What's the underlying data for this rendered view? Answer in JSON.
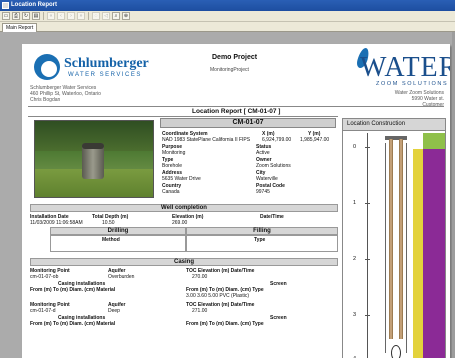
{
  "window": {
    "title": "Location Report"
  },
  "toolbar": {
    "buttons": [
      "open-icon",
      "print-icon",
      "refresh-icon",
      "export-icon",
      "first-page-icon",
      "prev-page-icon",
      "next-page-icon",
      "last-page-icon",
      "stop-icon",
      "back-icon",
      "find-icon",
      "zoom-icon"
    ]
  },
  "tabs": [
    {
      "label": "Main Report"
    }
  ],
  "header": {
    "company_left": "Schlumberger",
    "company_left_sub": "WATER SERVICES",
    "left_address": [
      "Schlumberger Water Services",
      "460 Phillip St, Waterloo, Ontario",
      "Chris Bogdan"
    ],
    "project_title": "Demo Project",
    "project_sub": "MonitoringProject",
    "company_right": "WATER",
    "company_right_sub": "ZOOM SOLUTIONS",
    "right_address": [
      "Water Zoom Solutions",
      "5990 Water st.",
      "Customer"
    ]
  },
  "report": {
    "title": "Location Report  [ CM-01-07 ]",
    "well_id": "CM-01-07",
    "coord_label": "Coordinate System",
    "coord_value": "NAD 1983 StatePlane California II FIPS",
    "x_label": "X (m)",
    "x_value": "6,924,799.00",
    "y_label": "Y (m)",
    "y_value": "1,985,947.00",
    "purpose_label": "Purpose",
    "purpose_value": "Monitoring",
    "status_label": "Status",
    "status_value": "Active",
    "type_label": "Type",
    "type_value": "Borehole",
    "owner_label": "Owner",
    "owner_value": "Zoom Solutions",
    "address_label": "Address",
    "address_value": "5635 Water Drive",
    "city_label": "City",
    "city_value": "Waterville",
    "country_label": "Country",
    "country_value": "Canada",
    "postal_label": "Postal Code",
    "postal_value": "99745"
  },
  "completion": {
    "title": "Well completion",
    "install_date_label": "Installation Date",
    "install_date_value": "11/03/2009 11:06:58AM",
    "depth_label": "Total Depth (m)",
    "depth_value": "10.50",
    "elev_label": "Elevation (m)",
    "elev_value": "269.00",
    "date_time_label": "Date/Time",
    "drilling_label": "Drilling",
    "method_label": "Method",
    "filling_label": "Filling",
    "type_label": "Type"
  },
  "casing": {
    "title": "Casing",
    "rows": [
      {
        "mp_label": "Monitoring Point",
        "mp_value": "cm-01-07-ob",
        "aquifer_label": "Aquifer",
        "aquifer_value": "Overburden",
        "toc_label": "TOC Elevation (m)  Date/Time",
        "toc_value": "270.00",
        "installs_label": "Casing installations",
        "screen_label": "Screen",
        "cols_left": "From (m)  To (m)  Diam. (cm)  Material",
        "cols_right": "From (m)  To (m)  Diam. (cm)  Type",
        "screen_values": "3.00      3.60      5.00      PVC (Plastic)"
      },
      {
        "mp_label": "Monitoring Point",
        "mp_value": "cm-01-07-d",
        "aquifer_label": "Aquifer",
        "aquifer_value": "Deep",
        "toc_label": "TOC Elevation (m)  Date/Time",
        "toc_value": "271.00",
        "installs_label": "Casing installations",
        "screen_label": "Screen",
        "cols_left": "From (m)  To (m)  Diam. (cm)  Material",
        "cols_right": "From (m)  To (m)  Diam. (cm)  Type"
      }
    ]
  },
  "construction": {
    "title": "Location Construction",
    "depth_ticks": [
      "0",
      "1",
      "2",
      "3",
      "4"
    ]
  },
  "colors": {
    "title_bar": "#1d4ea0",
    "brand_blue": "#1462a8",
    "purple": "#8b2a96",
    "yellow": "#e3d23c",
    "green": "#8fc04a",
    "band_gray": "#d6d6d6"
  }
}
